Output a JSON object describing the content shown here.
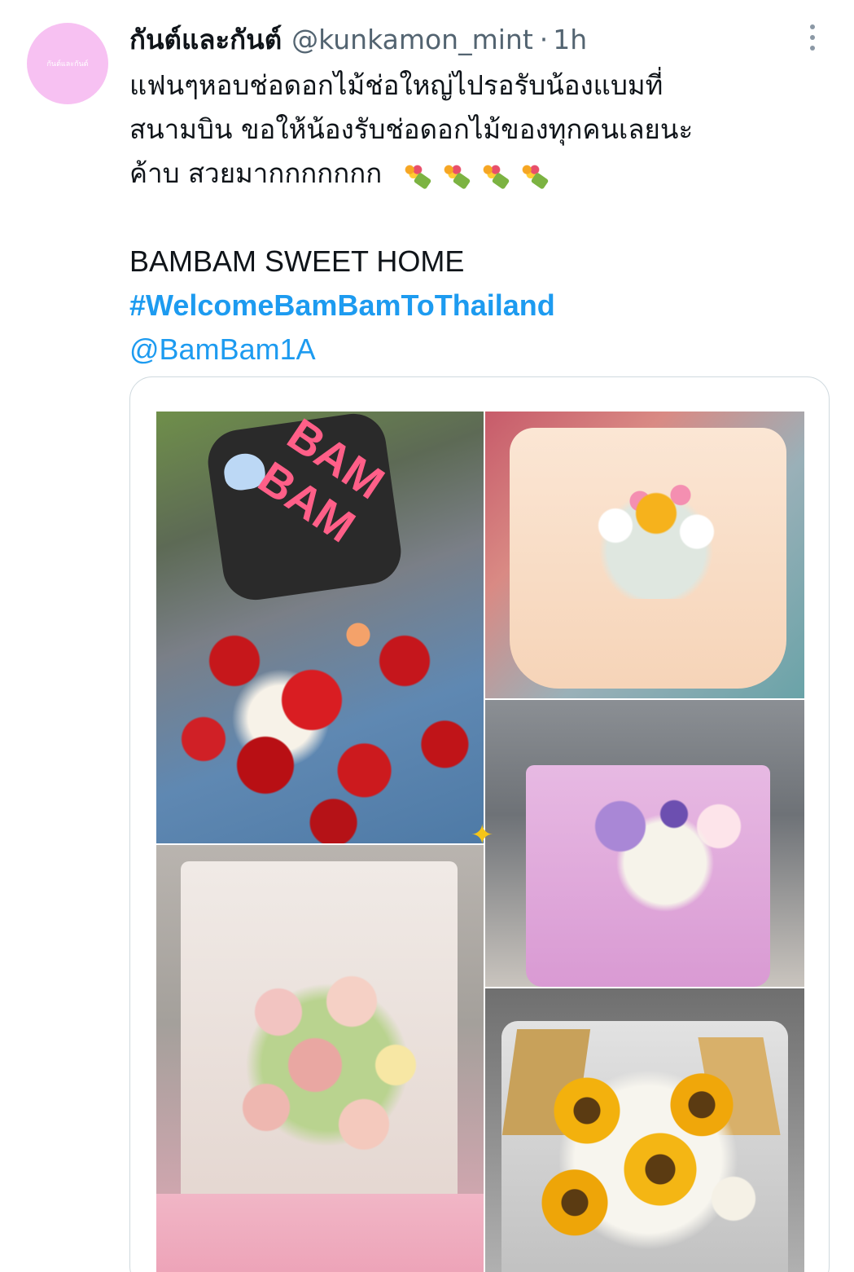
{
  "tweet": {
    "avatar_text": "กันต์และกันต์",
    "display_name": "กันต์และกันต์",
    "handle": "@kunkamon_mint",
    "separator": "·",
    "time": "1h",
    "more_icon": "more-vertical-icon",
    "text_lines": [
      "แฟนๆหอบช่อดอกไม้ช่อใหญ่ไปรอรับน้องแบมที่",
      "สนามบิน ขอให้น้องรับช่อดอกไม้ของทุกคนเลยนะ",
      "ค้าบ สวยมากกกกกกก"
    ],
    "emoji": "bouquet-emoji",
    "emoji_count": 4,
    "tagline": "BAMBAM SWEET HOME",
    "hashtag": "#WelcomeBamBamToThailand",
    "mention": "@BamBam1A",
    "media": {
      "sign_text": "BAM BAM",
      "photos": [
        "red-roses-photo",
        "cream-bouquet-photo",
        "purple-bouquet-photo",
        "pink-roses-photo",
        "sunflower-bouquet-photo"
      ]
    }
  }
}
